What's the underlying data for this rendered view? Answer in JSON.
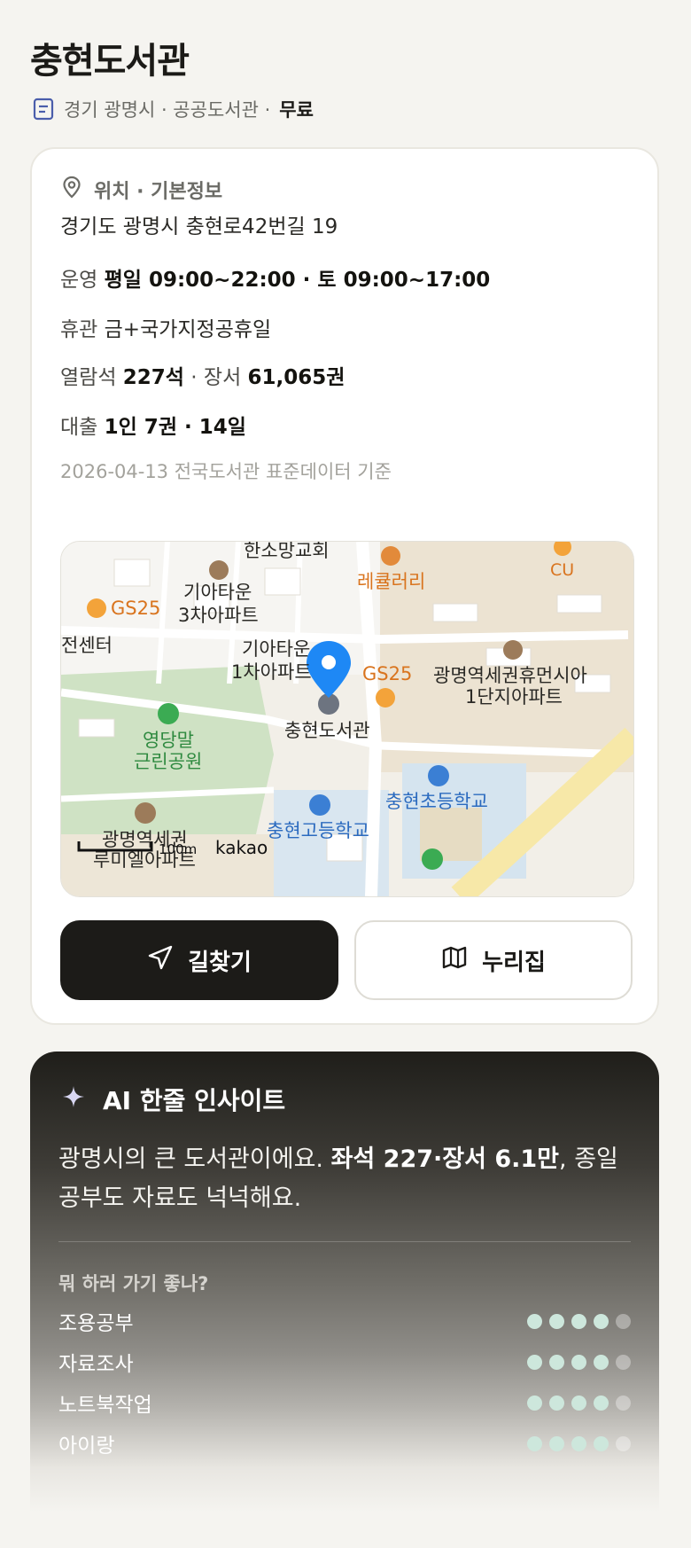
{
  "library": {
    "title": "충현도서관",
    "meta_region": "경기 광명시 · 공공도서관 ·",
    "meta_fee": "무료"
  },
  "info": {
    "section_title": "위치 · 기본정보",
    "address": "경기도 광명시 충현로42번길 19",
    "hours_label": "운영",
    "hours_value": "평일 09:00~22:00 · 토 09:00~17:00",
    "closed_label": "휴관",
    "closed_value": "금+국가지정공휴일",
    "seats_label": "열람석",
    "seats_value": "227석",
    "books_sep": "· 장서",
    "books_value": "61,065권",
    "loan_label": "대출",
    "loan_value": "1인 7권 · 14일",
    "source": "2026-04-13 전국도서관 표준데이터 기준"
  },
  "map": {
    "labels": {
      "hansomang": "한소망교회",
      "lecule": "레큘러리",
      "cu": "CU",
      "gs25_left": "GS25",
      "kia3_a": "기아타운",
      "kia3_b": "3차아파트",
      "center": "전센터",
      "kia1_a": "기아타운",
      "kia1_b": "1차아파트",
      "gs25_mid": "GS25",
      "gmstation_a": "광명역세권휴먼시아",
      "gmstation_b": "1단지아파트",
      "library": "충현도서관",
      "park_a": "영당말",
      "park_b": "근린공원",
      "elementary": "충현초등학교",
      "high": "충현고등학교",
      "lumiel_a": "광명역세권",
      "lumiel_b": "루미엘아파트",
      "scale": "100m",
      "brand": "kakao"
    }
  },
  "actions": {
    "directions": "길찾기",
    "website": "누리집"
  },
  "ai": {
    "title": "AI 한줄 인사이트",
    "text_1": "광명시의 큰 도서관이에요. ",
    "text_bold": "좌석 227·장서 6.1만",
    "text_2": ", 종일 공부도 자료도 넉넉해요.",
    "question": "뭐 하러 가기 좋나?",
    "ratings": [
      {
        "label": "조용공부",
        "score": 4,
        "max": 5
      },
      {
        "label": "자료조사",
        "score": 4,
        "max": 5
      },
      {
        "label": "노트북작업",
        "score": 4,
        "max": 5
      },
      {
        "label": "아이랑",
        "score": 4,
        "max": 5
      }
    ]
  },
  "colors": {
    "accent_dark": "#1c1b18",
    "pin_blue": "#1e88f5",
    "rating_on": "#cde7dc"
  }
}
